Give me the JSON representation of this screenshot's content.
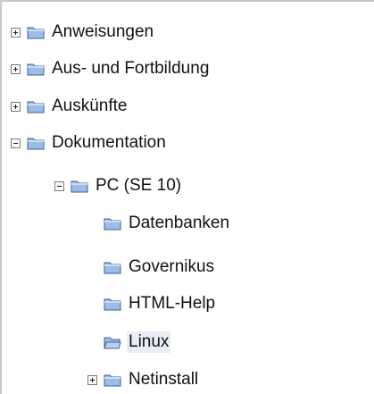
{
  "tree": {
    "items": [
      {
        "label": "Anweisungen",
        "toggle": "plus",
        "icon": "folder-closed-icon"
      },
      {
        "label": "Aus- und Fortbildung",
        "toggle": "plus",
        "icon": "folder-closed-icon"
      },
      {
        "label": "Auskünfte",
        "toggle": "plus",
        "icon": "folder-closed-icon"
      },
      {
        "label": "Dokumentation",
        "toggle": "minus",
        "icon": "folder-closed-icon"
      },
      {
        "label": "PC (SE 10)",
        "toggle": "minus",
        "icon": "folder-closed-icon"
      },
      {
        "label": "Datenbanken",
        "toggle": "none",
        "icon": "folder-closed-icon"
      },
      {
        "label": "Governikus",
        "toggle": "none",
        "icon": "folder-closed-icon"
      },
      {
        "label": "HTML-Help",
        "toggle": "none",
        "icon": "folder-closed-icon"
      },
      {
        "label": "Linux",
        "toggle": "none",
        "icon": "folder-open-icon",
        "selected": true
      },
      {
        "label": "Netinstall",
        "toggle": "plus",
        "icon": "folder-closed-icon"
      }
    ]
  },
  "colors": {
    "folder_fill": "#9dbde6",
    "folder_stroke": "#3b5f96",
    "selection": "#e9eef5"
  }
}
